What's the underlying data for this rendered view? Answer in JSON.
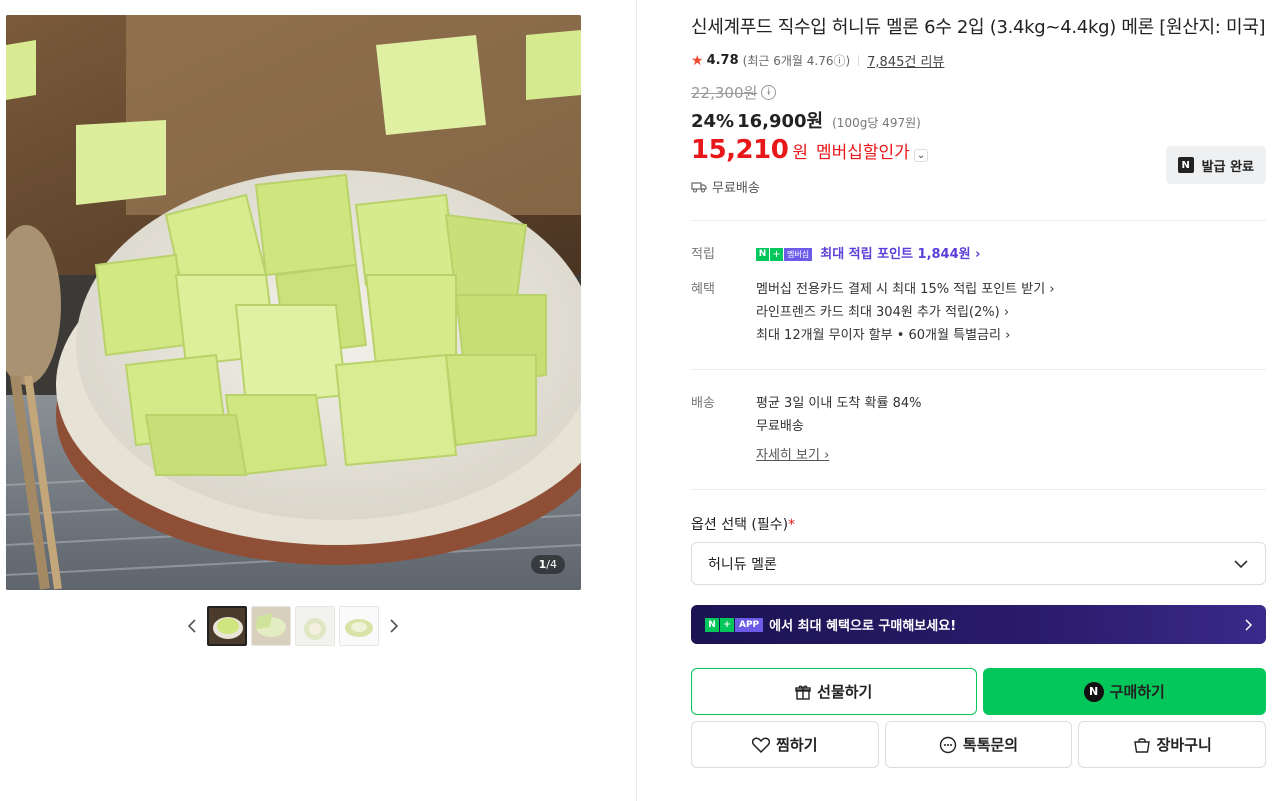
{
  "gallery": {
    "counter_current": "1",
    "counter_total": "/4",
    "thumb_count": 4,
    "active_thumb": 0
  },
  "product": {
    "title": "신세계푸드 직수입 허니듀 멜론 6수 2입 (3.4kg~4.4kg) 메론 [원산지: 미국]",
    "rating": "4.78",
    "recent_rating": "(최근 6개월 4.76ⓘ)",
    "review_count": "7,845건 리뷰",
    "original_price": "22,300원",
    "discount": "24%",
    "sale_price": "16,900원",
    "unit_price": "(100g당 497원)",
    "member_price": "15,210",
    "member_won": "원",
    "member_label": "멤버십할인가",
    "coupon_button": "발급 완료",
    "shipping_short": "무료배송"
  },
  "benefits": {
    "points_key": "적립",
    "points_badge_member": "멤버십",
    "points_text": "최대 적립 포인트 1,844원 ›",
    "benefit_key": "혜택",
    "benefit_lines": [
      "멤버십 전용카드 결제 시 최대 15% 적립 포인트 받기 ›",
      "라인프렌즈 카드 최대 304원 추가 적립(2%) ›",
      "최대 12개월 무이자 할부 • 60개월 특별금리 ›"
    ]
  },
  "delivery": {
    "key": "배송",
    "line1": "평균 3일 이내 도착 확률 84%",
    "line2": "무료배송",
    "detail_link": "자세히 보기 ›"
  },
  "options": {
    "label": "옵션 선택 (필수)",
    "required_mark": "*",
    "selected": "허니듀 멜론"
  },
  "app_banner": {
    "badge_app": "APP",
    "text": "에서 최대 혜택으로 구매해보세요!"
  },
  "buttons": {
    "gift": "선물하기",
    "buy": "구매하기",
    "wish": "찜하기",
    "talk": "톡톡문의",
    "cart": "장바구니"
  },
  "colors": {
    "brand_green": "#03c75a",
    "price_red": "#e8171a",
    "point_purple": "#5b3fd8",
    "banner_dark": "#1b1352"
  }
}
